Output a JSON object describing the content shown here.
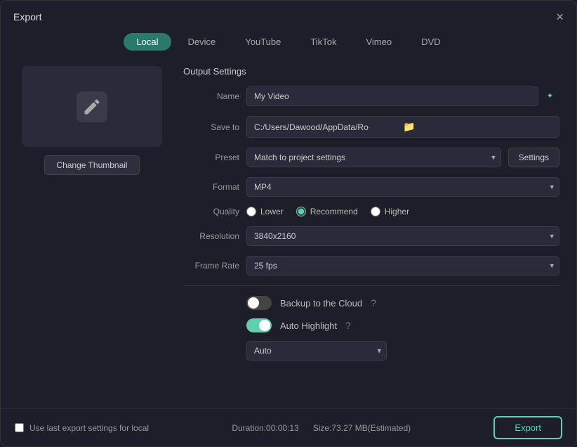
{
  "dialog": {
    "title": "Export",
    "close_label": "×"
  },
  "tabs": [
    {
      "id": "local",
      "label": "Local",
      "active": true
    },
    {
      "id": "device",
      "label": "Device",
      "active": false
    },
    {
      "id": "youtube",
      "label": "YouTube",
      "active": false
    },
    {
      "id": "tiktok",
      "label": "TikTok",
      "active": false
    },
    {
      "id": "vimeo",
      "label": "Vimeo",
      "active": false
    },
    {
      "id": "dvd",
      "label": "DVD",
      "active": false
    }
  ],
  "output_settings": {
    "section_title": "Output Settings",
    "name_label": "Name",
    "name_value": "My Video",
    "save_to_label": "Save to",
    "save_to_value": "C:/Users/Dawood/AppData/Ro",
    "preset_label": "Preset",
    "preset_value": "Match to project settings",
    "settings_btn": "Settings",
    "format_label": "Format",
    "format_value": "MP4",
    "quality_label": "Quality",
    "quality_options": [
      "Lower",
      "Recommend",
      "Higher"
    ],
    "quality_selected": "Recommend",
    "resolution_label": "Resolution",
    "resolution_value": "3840x2160",
    "frame_rate_label": "Frame Rate",
    "frame_rate_value": "25 fps",
    "backup_label": "Backup to the Cloud",
    "backup_enabled": false,
    "auto_highlight_label": "Auto Highlight",
    "auto_highlight_enabled": true,
    "auto_value": "Auto"
  },
  "bottom": {
    "checkbox_label": "Use last export settings for local",
    "duration_label": "Duration:00:00:13",
    "size_label": "Size:73.27 MB(Estimated)",
    "export_label": "Export"
  },
  "change_thumbnail": "Change Thumbnail"
}
